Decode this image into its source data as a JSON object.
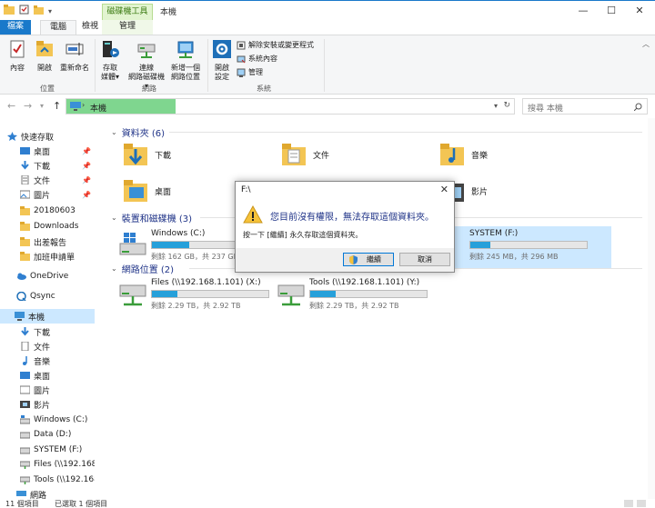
{
  "window": {
    "context_tab_label": "磁碟機工具",
    "title": "本機",
    "controls": {
      "minimize": "—",
      "maximize": "☐",
      "close": "✕"
    }
  },
  "tabs": [
    "檔案",
    "電腦",
    "檢視",
    "管理"
  ],
  "ribbon": {
    "location_group": {
      "label": "位置",
      "buttons": [
        "內容",
        "開啟",
        "重新命名"
      ]
    },
    "network_group": {
      "label": "網路",
      "buttons": [
        {
          "line1": "存取",
          "line2": "媒體▾"
        },
        {
          "line1": "連線",
          "line2": "網路磁碟機▾"
        },
        {
          "line1": "新增一個",
          "line2": "網路位置"
        }
      ]
    },
    "system_group": {
      "label": "系統",
      "open_settings": {
        "line1": "開啟",
        "line2": "設定"
      },
      "items": [
        "解除安裝或變更程式",
        "系統內容",
        "管理"
      ]
    },
    "collapse_icon": "chevron-up-icon"
  },
  "navigation": {
    "address_path": "本機",
    "search_placeholder": "搜尋 本機"
  },
  "sidebar": {
    "quick_access": "快速存取",
    "items": [
      {
        "label": "桌面",
        "pinned": true
      },
      {
        "label": "下載",
        "pinned": true
      },
      {
        "label": "文件",
        "pinned": true
      },
      {
        "label": "圖片",
        "pinned": true
      },
      {
        "label": "20180603",
        "pinned": false
      },
      {
        "label": "Downloads",
        "pinned": false
      },
      {
        "label": "出差報告",
        "pinned": false
      },
      {
        "label": "加班申請單",
        "pinned": false
      }
    ],
    "onedrive": "OneDrive",
    "qsync": "Qsync",
    "this_pc": "本機",
    "pc_items": [
      "下載",
      "文件",
      "音樂",
      "桌面",
      "圖片",
      "影片",
      "Windows (C:)",
      "Data (D:)",
      "SYSTEM (F:)",
      "Files (\\\\192.168.1.",
      "Tools (\\\\192.168."
    ],
    "partial_label": "網路"
  },
  "main": {
    "folders_header": "資料夾 (6)",
    "folders": [
      "下載",
      "文件",
      "音樂",
      "桌面",
      "影片"
    ],
    "devices_header": "裝置和磁碟機 (3)",
    "drives": [
      {
        "name": "Windows (C:)",
        "caption": "剩餘 162 GB，共 237 GB",
        "used": 0.32
      },
      {
        "name": "SYSTEM (F:)",
        "caption": "剩餘 245 MB，共 296 MB",
        "used": 0.17
      }
    ],
    "network_header": "網路位置 (2)",
    "network_drives": [
      {
        "name": "Files (\\\\192.168.1.101) (X:)",
        "caption": "剩餘 2.29 TB，共 2.92 TB",
        "used": 0.22
      },
      {
        "name": "Tools (\\\\192.168.1.101) (Y:)",
        "caption": "剩餘 2.29 TB，共 2.92 TB",
        "used": 0.22
      }
    ]
  },
  "status": {
    "count": "11 個項目",
    "selected": "已選取 1 個項目"
  },
  "dialog": {
    "title": "F:\\",
    "message": "您目前沒有權限，無法存取這個資料夾。",
    "detail": "按一下 [繼續] 永久存取這個資料夾。",
    "continue_label": "繼續",
    "cancel_label": "取消"
  },
  "colors": {
    "accent": "#1979ca",
    "context_tab": "#e2f4d0",
    "address_highlight": "#7fd68f",
    "selection": "#cce8ff",
    "drive_bar": "#26a0da"
  }
}
